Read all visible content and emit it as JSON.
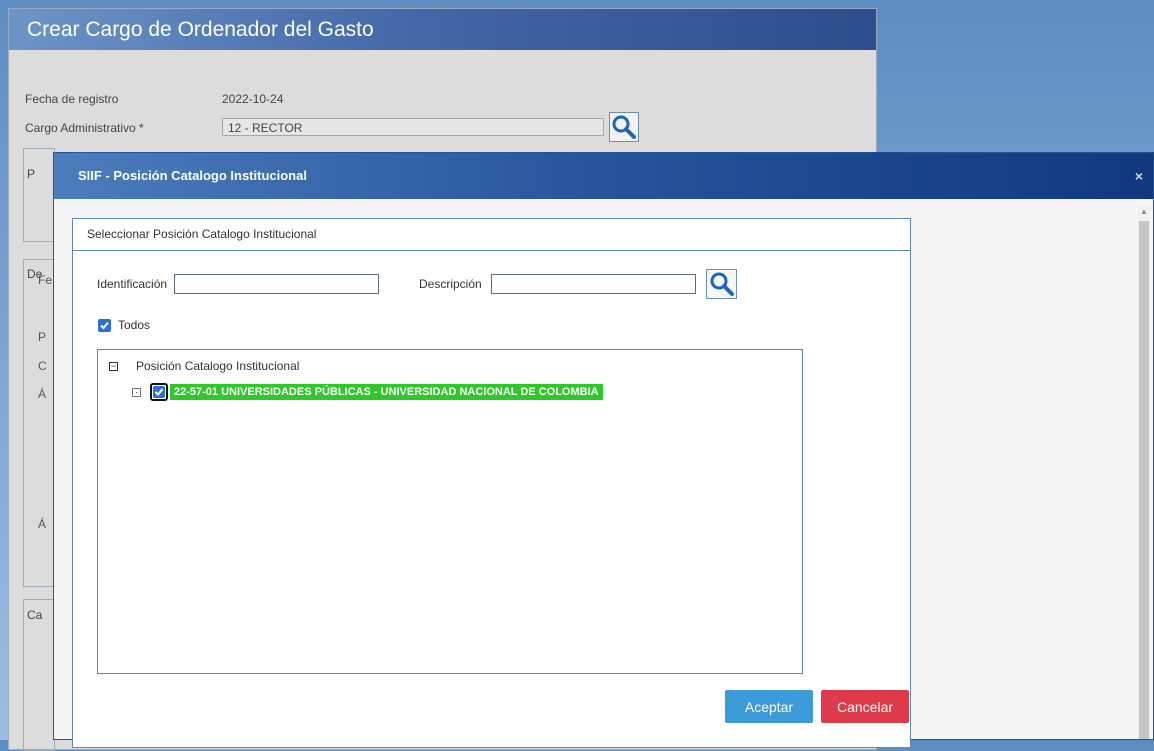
{
  "page": {
    "title": "Crear Cargo de Ordenador del Gasto",
    "fecha_label": "Fecha de registro",
    "fecha_value": "2022-10-24",
    "cargo_label": "Cargo Administrativo *",
    "cargo_value": "12 - RECTOR",
    "partial_labels": [
      "P",
      "De",
      "Fe",
      "P",
      "C",
      "Á",
      "Á",
      "Ca"
    ]
  },
  "modal": {
    "title": "SIIF - Posición Catalogo Institucional",
    "close": "×",
    "panel_title": "Seleccionar Posición Catalogo Institucional",
    "identificacion_label": "Identificación",
    "identificacion_value": "",
    "descripcion_label": "Descripción",
    "descripcion_value": "",
    "todos_label": "Todos",
    "todos_checked": true,
    "tree": {
      "root_label": "Posición Catalogo Institucional",
      "root_toggle": "−",
      "child_toggle": "·",
      "child_label": "22-57-01 UNIVERSIDADES PÚBLICAS - UNIVERSIDAD NACIONAL DE COLOMBIA",
      "child_checked": true
    },
    "accept_label": "Aceptar",
    "cancel_label": "Cancelar"
  },
  "colors": {
    "header_blue": "#2a5190",
    "highlight_green": "#2ec928",
    "accept_blue": "#3c9ad9",
    "cancel_red": "#df3a4a"
  },
  "icons": [
    "search-icon",
    "close-icon",
    "check-icon",
    "collapse-icon",
    "expand-icon"
  ]
}
